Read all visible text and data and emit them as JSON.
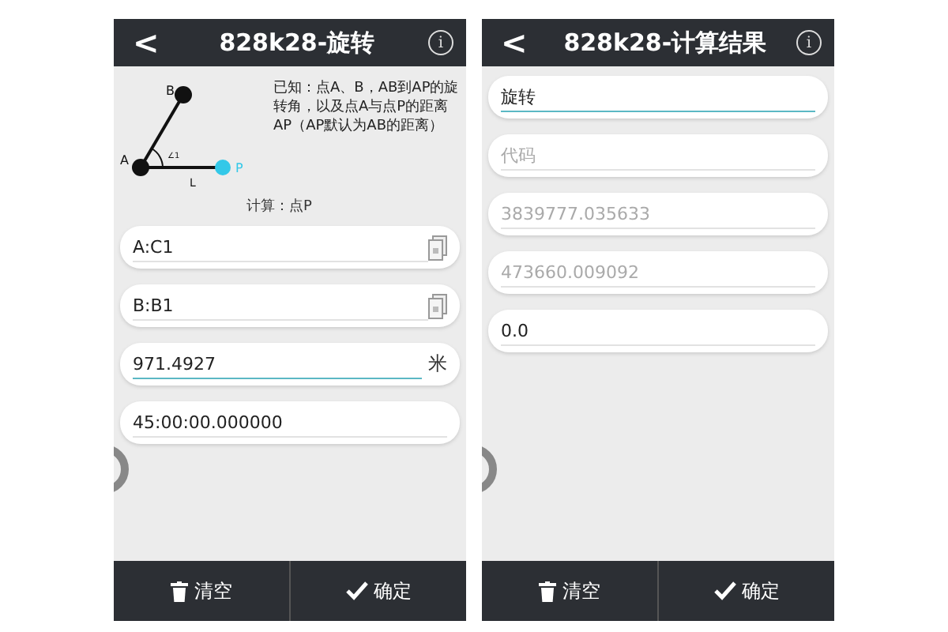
{
  "screens": [
    {
      "title": "828k28-旋转",
      "back": "<",
      "info": "i",
      "description": "已知：点A、B，AB到AP的旋转角，以及点A与点P的距离AP（AP默认为AB的距离）",
      "diagram": {
        "point_b": "B",
        "point_a": "A",
        "point_p": "P",
        "angle": "∠1",
        "line": "L"
      },
      "section": "计算：点P",
      "fields": [
        {
          "kind": "source",
          "text": "A:C1",
          "focused": false
        },
        {
          "kind": "source",
          "text": "B:B1",
          "focused": false
        },
        {
          "kind": "value",
          "text": "971.4927",
          "focused": true,
          "suffix": "米"
        },
        {
          "kind": "value",
          "text": "45:00:00.000000",
          "focused": false
        }
      ],
      "buttons": [
        {
          "kind": "clear",
          "label": "清空"
        },
        {
          "kind": "ok",
          "label": "确定"
        }
      ]
    },
    {
      "title": "828k28-计算结果",
      "back": "<",
      "info": "i",
      "fields": [
        {
          "kind": "value",
          "text": "旋转",
          "focused": true
        },
        {
          "kind": "placeholder",
          "text": "代码",
          "focused": false
        },
        {
          "kind": "placeholder",
          "text": "3839777.035633",
          "focused": false
        },
        {
          "kind": "placeholder",
          "text": "473660.009092",
          "focused": false
        },
        {
          "kind": "value",
          "text": "0.0",
          "focused": false
        }
      ],
      "buttons": [
        {
          "kind": "clear",
          "label": "清空"
        },
        {
          "kind": "ok",
          "label": "确定"
        }
      ]
    }
  ]
}
